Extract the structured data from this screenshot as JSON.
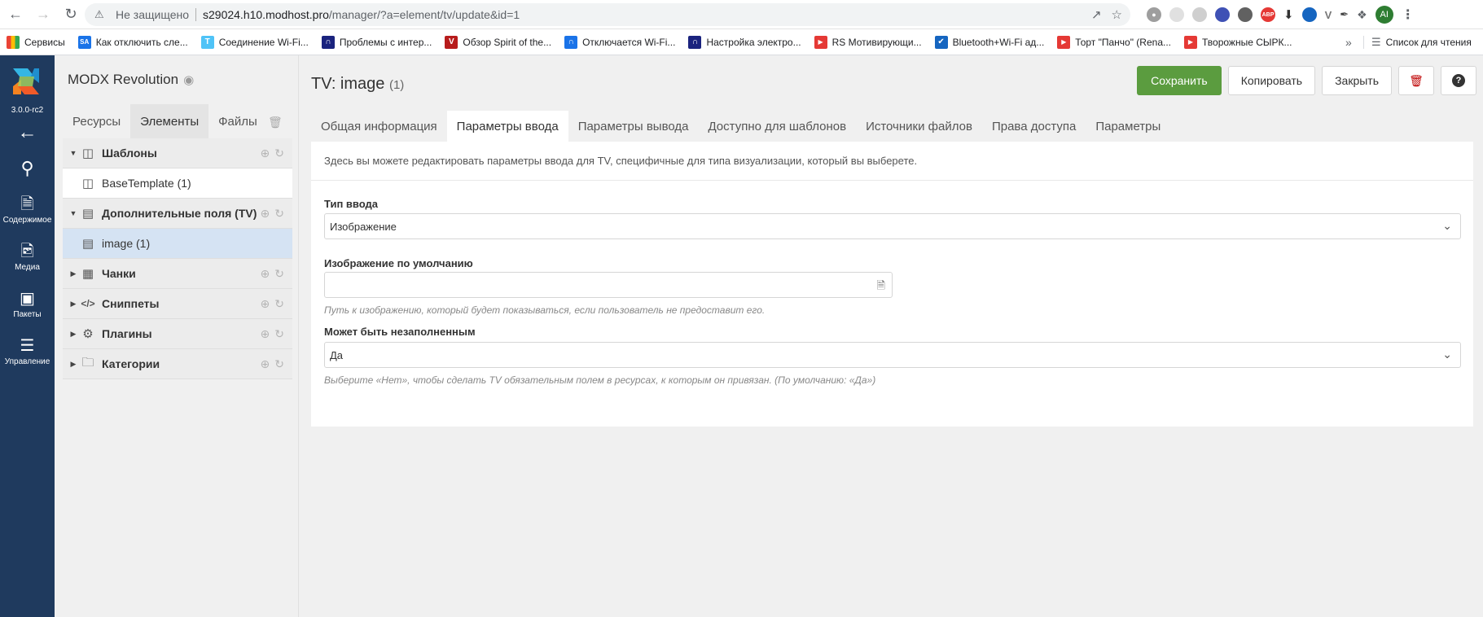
{
  "browser": {
    "not_secure": "Не защищено",
    "url_host": "s29024.h10.modhost.pro",
    "url_path": "/manager/?a=element/tv/update&id=1",
    "avatar": "AI",
    "ext_abp": "ABP",
    "bookmarks": [
      {
        "label": "Сервисы",
        "icon": "apps-grid-icon",
        "color": "#ea4335"
      },
      {
        "label": "Как отключить сле...",
        "icon": "sa-icon",
        "color": "#1a73e8"
      },
      {
        "label": "Соединение Wi-Fi...",
        "icon": "t-icon",
        "color": "#4fc3f7"
      },
      {
        "label": "Проблемы с интер...",
        "icon": "router-icon",
        "color": "#1a237e"
      },
      {
        "label": "Обзор Spirit of the...",
        "icon": "vr-icon",
        "color": "#b71c1c"
      },
      {
        "label": "Отключается Wi-Fi...",
        "icon": "router-icon",
        "color": "#1a73e8"
      },
      {
        "label": "Настройка электро...",
        "icon": "router-icon",
        "color": "#1a237e"
      },
      {
        "label": "RS Мотивирующи...",
        "icon": "youtube-icon",
        "color": "#e53935"
      },
      {
        "label": "Bluetooth+Wi-Fi ад...",
        "icon": "cart-icon",
        "color": "#1565c0"
      },
      {
        "label": "Торт \"Панчо\" (Rena...",
        "icon": "youtube-icon",
        "color": "#e53935"
      },
      {
        "label": "Творожные СЫРК...",
        "icon": "youtube-icon",
        "color": "#e53935"
      }
    ],
    "reading_list": "Список для чтения"
  },
  "modx_nav": {
    "version": "3.0.0-rc2",
    "items": [
      {
        "label": "Содержимое",
        "icon": "document-icon"
      },
      {
        "label": "Медиа",
        "icon": "image-icon"
      },
      {
        "label": "Пакеты",
        "icon": "box-icon"
      },
      {
        "label": "Управление",
        "icon": "sliders-icon"
      }
    ]
  },
  "tree": {
    "site_name": "MODX Revolution",
    "tabs": [
      "Ресурсы",
      "Элементы",
      "Файлы"
    ],
    "active_tab": "Элементы",
    "rows": [
      {
        "label": "Шаблоны",
        "kind": "category",
        "expanded": true,
        "icon": "template-icon"
      },
      {
        "label": "BaseTemplate (1)",
        "kind": "child",
        "icon": "template-icon"
      },
      {
        "label": "Дополнительные поля (TV)",
        "kind": "category",
        "expanded": true,
        "icon": "tv-list-icon"
      },
      {
        "label": "image (1)",
        "kind": "child",
        "selected": true,
        "icon": "tv-list-icon"
      },
      {
        "label": "Чанки",
        "kind": "category",
        "expanded": false,
        "icon": "chunks-icon"
      },
      {
        "label": "Сниппеты",
        "kind": "category",
        "expanded": false,
        "icon": "code-icon"
      },
      {
        "label": "Плагины",
        "kind": "category",
        "expanded": false,
        "icon": "gears-icon"
      },
      {
        "label": "Категории",
        "kind": "category",
        "expanded": false,
        "icon": "folder-icon"
      }
    ]
  },
  "main": {
    "title": "TV: image",
    "title_count": "(1)",
    "buttons": {
      "save": "Сохранить",
      "copy": "Копировать",
      "close": "Закрыть"
    },
    "tabs": [
      "Общая информация",
      "Параметры ввода",
      "Параметры вывода",
      "Доступно для шаблонов",
      "Источники файлов",
      "Права доступа",
      "Параметры"
    ],
    "active_tab": "Параметры ввода",
    "intro": "Здесь вы можете редактировать параметры ввода для TV, специфичные для типа визуализации, который вы выберете.",
    "fields": {
      "input_type_label": "Тип ввода",
      "input_type_value": "Изображение",
      "default_image_label": "Изображение по умолчанию",
      "default_image_value": "",
      "default_image_hint": "Путь к изображению, который будет показываться, если пользователь не предоставит его.",
      "allow_blank_label": "Может быть незаполненным",
      "allow_blank_value": "Да",
      "allow_blank_hint": "Выберите «Нет», чтобы сделать TV обязательным полем в ресурсах, к которым он привязан. (По умолчанию: «Да»)"
    }
  },
  "colors": {
    "nav_bg": "#1f3a5e",
    "save_green": "#5b9c3f",
    "selected_row": "#d5e3f3",
    "delete_red": "#be0000"
  }
}
